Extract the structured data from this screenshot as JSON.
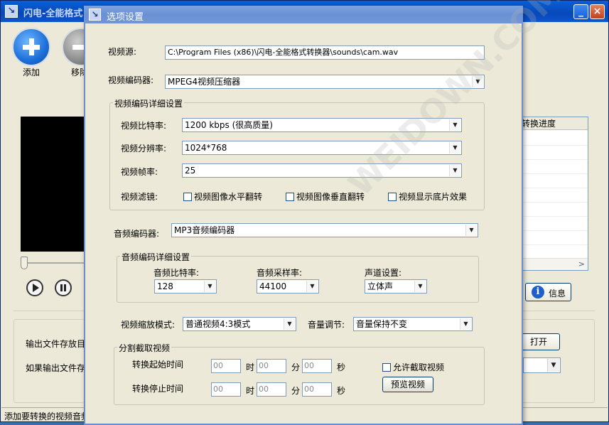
{
  "main_window": {
    "title": "闪电-全能格式",
    "add_label": "添加",
    "remove_label": "移除",
    "list_header": "转换进度",
    "info_label": "信息",
    "open_label": "打开",
    "output_dir_label": "输出文件存放目",
    "if_output_exists_label": "如果输出文件存",
    "status_text": "添加要转换的视频音频"
  },
  "dialog": {
    "title": "选项设置",
    "video_source_label": "视频源:",
    "video_source_value": "C:\\Program Files (x86)\\闪电-全能格式转换器\\sounds\\cam.wav",
    "video_encoder_label": "视频编码器:",
    "video_encoder_value": "MPEG4视频压缩器",
    "video_detail_group": "视频编码详细设置",
    "video_bitrate_label": "视频比特率:",
    "video_bitrate_value": "1200 kbps (很高质量)",
    "video_resolution_label": "视频分辨率:",
    "video_resolution_value": "1024*768",
    "video_fps_label": "视频帧率:",
    "video_fps_value": "25",
    "video_filter_label": "视频滤镜:",
    "filter_hflip": "视频图像水平翻转",
    "filter_vflip": "视频图像垂直翻转",
    "filter_negative": "视频显示底片效果",
    "audio_encoder_label": "音频编码器:",
    "audio_encoder_value": "MP3音频编码器",
    "audio_detail_group": "音频编码详细设置",
    "audio_bitrate_label": "音频比特率:",
    "audio_bitrate_value": "128",
    "audio_samplerate_label": "音频采样率:",
    "audio_samplerate_value": "44100",
    "channel_label": "声道设置:",
    "channel_value": "立体声",
    "scale_mode_label": "视频缩放模式:",
    "scale_mode_value": "普通视频4:3模式",
    "volume_label": "音量调节:",
    "volume_value": "音量保持不变",
    "clip_group": "分割截取视频",
    "start_time_label": "转换起始时间",
    "stop_time_label": "转换停止时间",
    "hour_unit": "时",
    "minute_unit": "分",
    "second_unit": "秒",
    "time_placeholder": "00",
    "allow_clip_label": "允许截取视频",
    "preview_label": "预览视频"
  },
  "watermark": "WEIDOWN.COM"
}
